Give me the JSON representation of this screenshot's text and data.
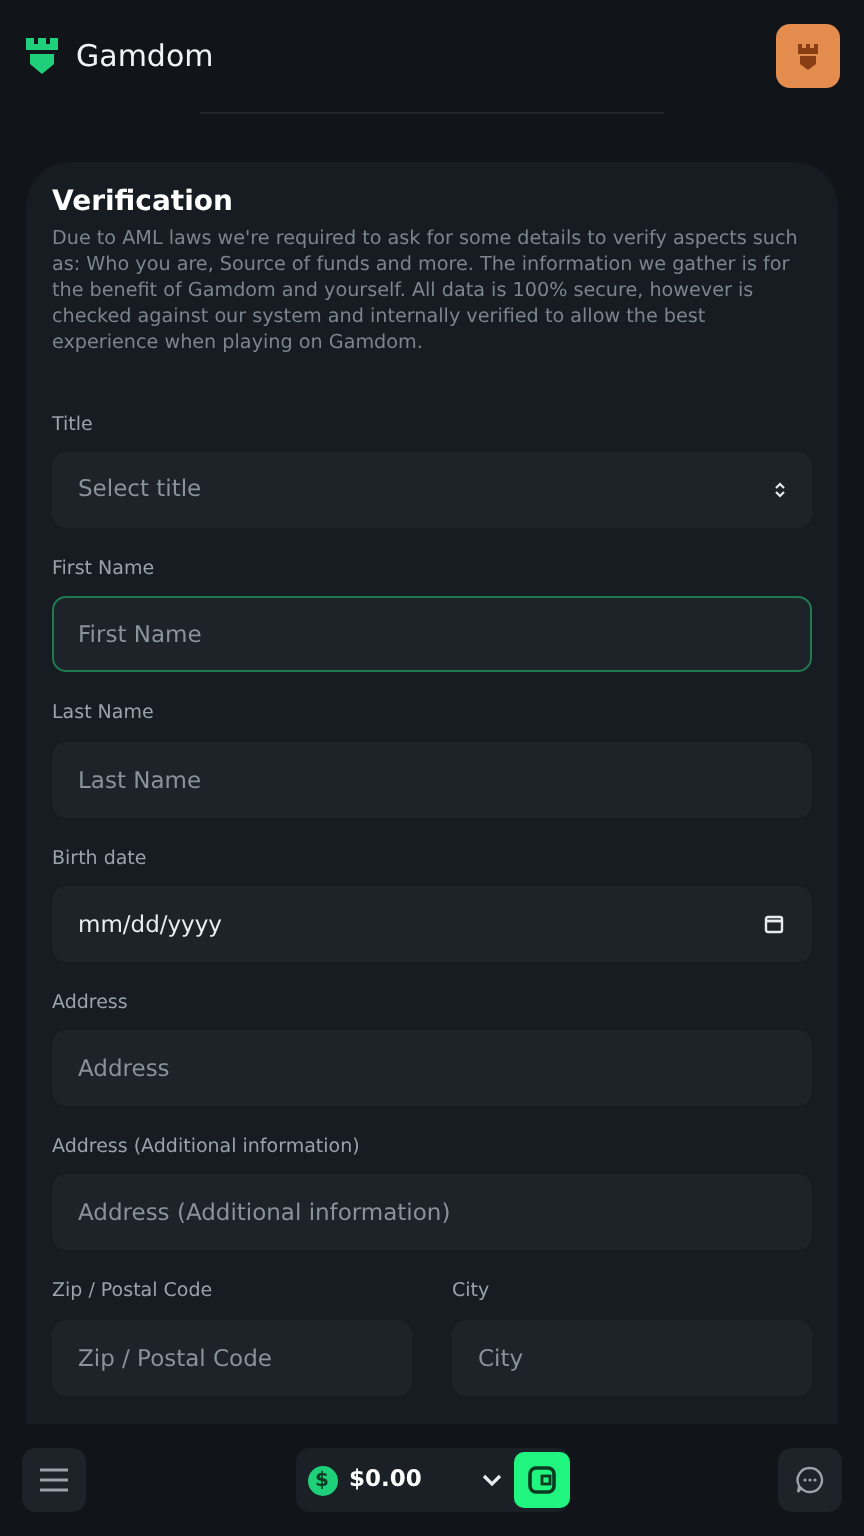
{
  "header": {
    "brand": "Gamdom"
  },
  "verification": {
    "title": "Verification",
    "description": "Due to AML laws we're required to ask for some details to verify aspects such as: Who you are, Source of funds and more. The information we gather is for the benefit of Gamdom and yourself. All data is 100% secure, however is checked against our system and internally verified to allow the best experience when playing on Gamdom.",
    "rows": [
      [
        {
          "kind": "select",
          "label": "Title",
          "placeholder": "Select title",
          "focused": false
        }
      ],
      [
        {
          "kind": "text",
          "label": "First Name",
          "placeholder": "First Name",
          "focused": true
        }
      ],
      [
        {
          "kind": "text",
          "label": "Last Name",
          "placeholder": "Last Name",
          "focused": false
        }
      ],
      [
        {
          "kind": "date",
          "label": "Birth date",
          "value": "mm/dd/yyyy",
          "focused": false
        }
      ],
      [
        {
          "kind": "text",
          "label": "Address",
          "placeholder": "Address",
          "focused": false
        }
      ],
      [
        {
          "kind": "text",
          "label": "Address (Additional information)",
          "placeholder": "Address (Additional information)",
          "focused": false
        }
      ],
      [
        {
          "kind": "text",
          "label": "Zip / Postal Code",
          "placeholder": "Zip / Postal Code",
          "focused": false
        },
        {
          "kind": "text",
          "label": "City",
          "placeholder": "City",
          "focused": false
        }
      ]
    ]
  },
  "bottom_bar": {
    "coin_symbol": "$",
    "balance": "$0.00"
  }
}
